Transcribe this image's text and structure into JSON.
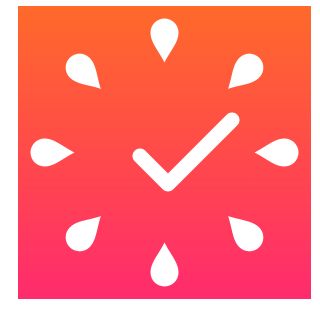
{
  "app_icon": {
    "icon_name": "focus-timer-checkmark-icon",
    "colors": {
      "gradient_top": "#FF6A2A",
      "gradient_middle": "#FF4A4A",
      "gradient_bottom": "#FF2B6E",
      "glyph": "#FFFFFF"
    },
    "clock_markers": 8,
    "marker_shape": "teardrop"
  }
}
